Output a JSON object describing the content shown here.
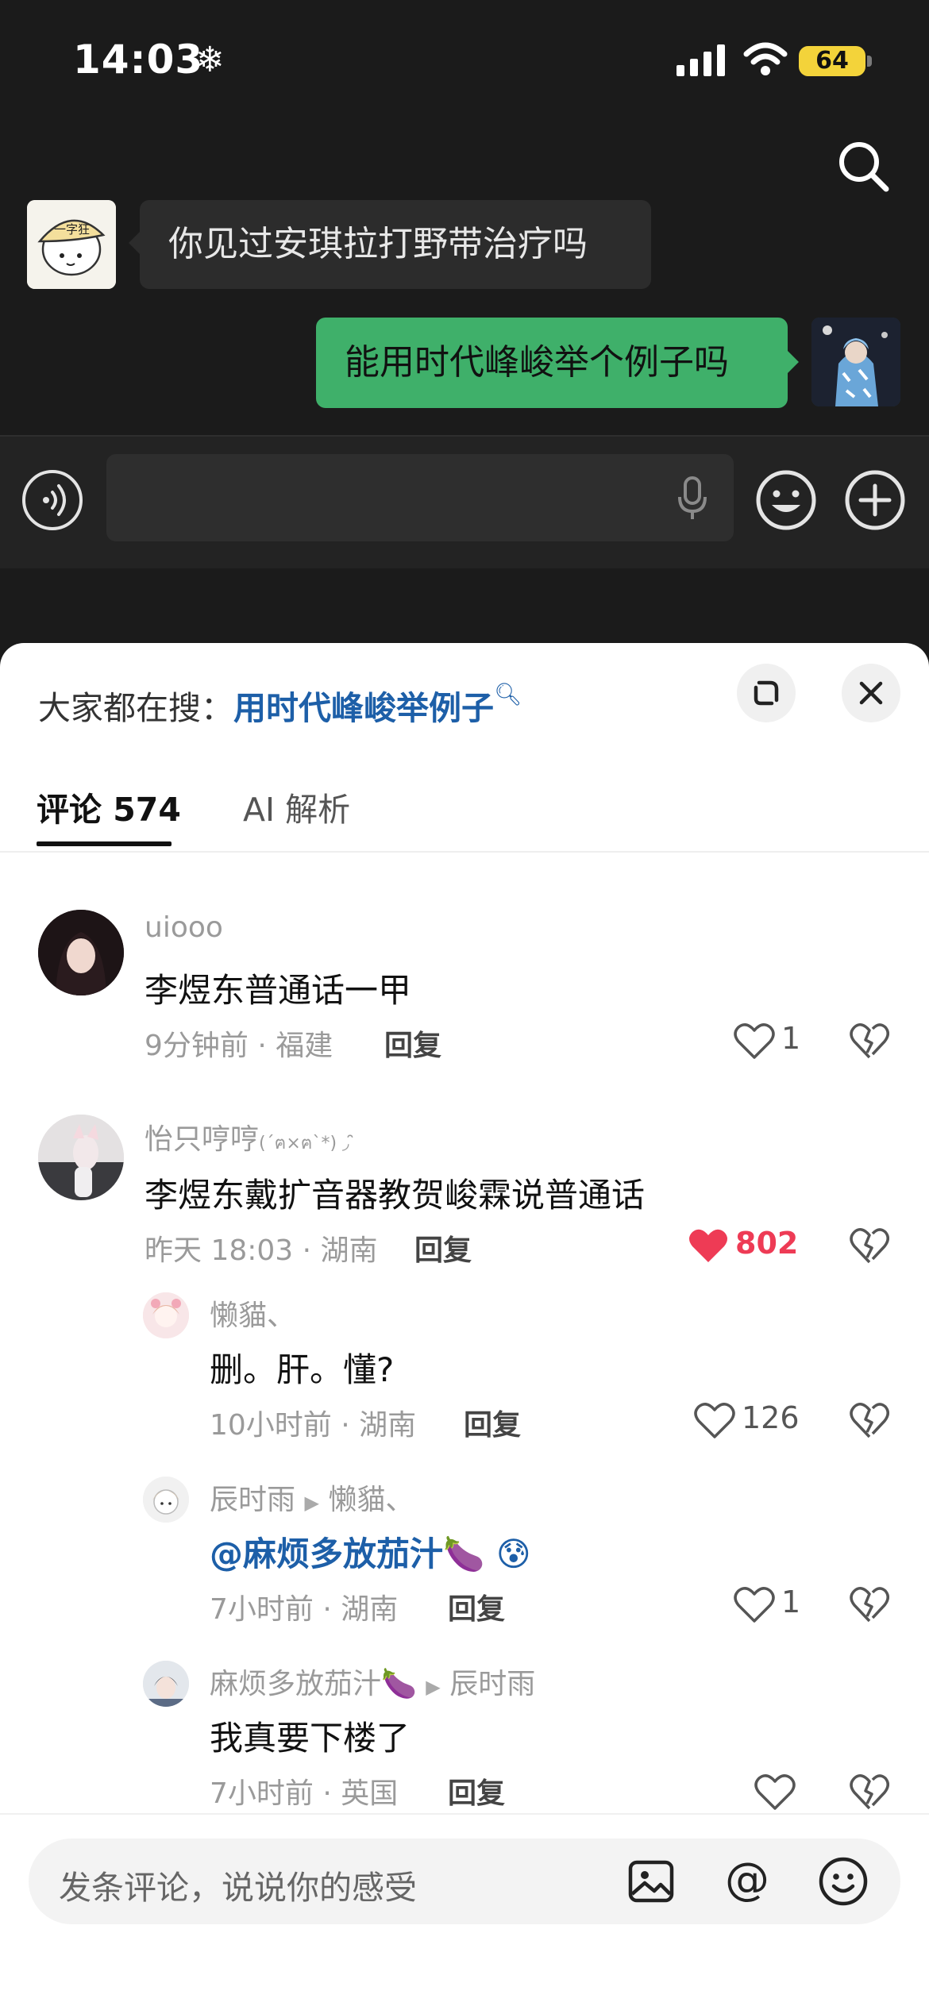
{
  "status_bar": {
    "time": "14:03",
    "weather_glyph": "❄",
    "battery": "64"
  },
  "chat": {
    "messages": [
      {
        "side": "left",
        "text": "你见过安琪拉打野带治疗吗"
      },
      {
        "side": "right",
        "text": "能用时代峰峻举个例子吗"
      }
    ],
    "avatar_left_text": "一字狂"
  },
  "sheet": {
    "hot_search_label": "大家都在搜：",
    "hot_search_term": "用时代峰峻举例子",
    "tabs": [
      {
        "label": "评论 574"
      },
      {
        "label": "AI 解析"
      }
    ],
    "comments": [
      {
        "user": "uiooo",
        "text": "李煜东普通话一甲",
        "meta": "9分钟前 · 福建",
        "reply": "回复",
        "likes": "1"
      },
      {
        "user": "怡只哼哼",
        "user_suffix": "(´ฅ×ฅ`*) ◞ ̑̑",
        "text": "李煜东戴扩音器教贺峻霖说普通话",
        "meta": "昨天 18:03 · 湖南",
        "reply": "回复",
        "likes": "802",
        "replies": [
          {
            "user": "懒貓、",
            "text": "删。肝。懂?",
            "meta": "10小时前 · 湖南",
            "reply": "回复",
            "likes": "126"
          },
          {
            "user": "辰时雨",
            "to": "懒貓、",
            "text": "@麻烦多放茄汁🍆 😰",
            "meta": "7小时前 · 湖南",
            "reply": "回复",
            "likes": "1"
          },
          {
            "user": "麻烦多放茄汁🍆",
            "to": "辰时雨",
            "text": "我真要下楼了",
            "meta": "7小时前 · 英国",
            "reply": "回复",
            "likes": ""
          }
        ]
      }
    ],
    "input_placeholder": "发条评论，说说你的感受",
    "accent_color": "#ee3b55",
    "link_color": "#1d5fa8"
  }
}
